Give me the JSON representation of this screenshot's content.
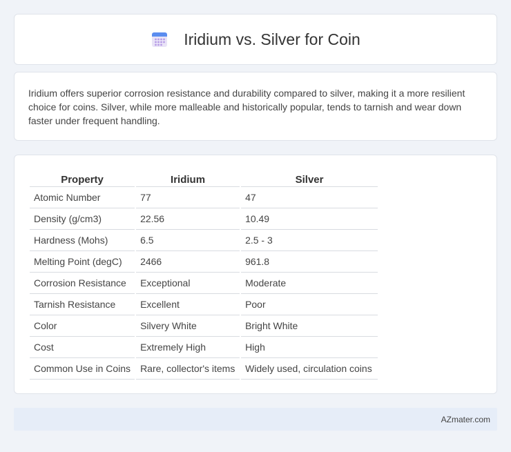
{
  "header": {
    "icon": "calendar-icon",
    "title": "Iridium vs. Silver for Coin"
  },
  "intro": {
    "text": "Iridium offers superior corrosion resistance and durability compared to silver, making it a more resilient choice for coins. Silver, while more malleable and historically popular, tends to tarnish and wear down faster under frequent handling."
  },
  "table": {
    "headers": [
      "Property",
      "Iridium",
      "Silver"
    ],
    "rows": [
      [
        "Atomic Number",
        "77",
        "47"
      ],
      [
        "Density (g/cm3)",
        "22.56",
        "10.49"
      ],
      [
        "Hardness (Mohs)",
        "6.5",
        "2.5 - 3"
      ],
      [
        "Melting Point (degC)",
        "2466",
        "961.8"
      ],
      [
        "Corrosion Resistance",
        "Exceptional",
        "Moderate"
      ],
      [
        "Tarnish Resistance",
        "Excellent",
        "Poor"
      ],
      [
        "Color",
        "Silvery White",
        "Bright White"
      ],
      [
        "Cost",
        "Extremely High",
        "High"
      ],
      [
        "Common Use in Coins",
        "Rare, collector's items",
        "Widely used, circulation coins"
      ]
    ]
  },
  "footer": {
    "brand": "AZmater.com"
  }
}
